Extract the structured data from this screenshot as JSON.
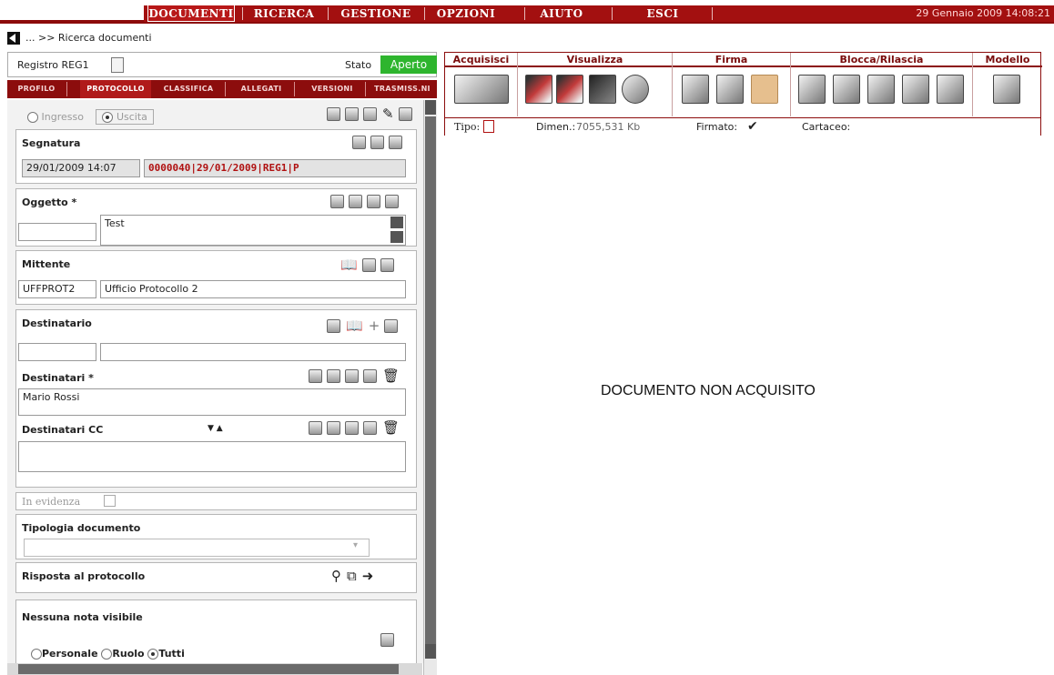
{
  "menu": {
    "items": [
      "DOCUMENTI",
      "RICERCA",
      "GESTIONE",
      "OPZIONI",
      "AIUTO",
      "ESCI"
    ],
    "datetime": "29 Gennaio 2009 14:08:21"
  },
  "breadcrumb": "... >> Ricerca documenti",
  "registro": {
    "label": "Registro REG1",
    "stato_label": "Stato",
    "stato_value": "Aperto"
  },
  "tabs": [
    "PROFILO",
    "PROTOCOLLO",
    "CLASSIFICA",
    "ALLEGATI",
    "VERSIONI",
    "TRASMISS.NI"
  ],
  "direction": {
    "ingresso": "Ingresso",
    "uscita": "Uscita"
  },
  "segnatura": {
    "title": "Segnatura",
    "date": "29/01/2009 14:07",
    "code": "0000040|29/01/2009|REG1|P"
  },
  "oggetto": {
    "title": "Oggetto *",
    "text": "Test"
  },
  "mittente": {
    "title": "Mittente",
    "code": "UFFPROT2",
    "desc": "Ufficio Protocollo 2"
  },
  "destinatario": {
    "title": "Destinatario"
  },
  "destinatari": {
    "title": "Destinatari *",
    "value": "Mario Rossi"
  },
  "destinatari_cc": {
    "title": "Destinatari CC"
  },
  "evidenza": {
    "label": "In evidenza"
  },
  "tipologia": {
    "title": "Tipologia documento"
  },
  "risposta": {
    "title": "Risposta al protocollo"
  },
  "note": {
    "title": "Nessuna nota visibile",
    "options": [
      "Personale",
      "Ruolo",
      "Tutti"
    ]
  },
  "toolbar": {
    "groups": [
      "Acquisisci",
      "Visualizza",
      "Firma",
      "Blocca/Rilascia",
      "Modello"
    ],
    "info": {
      "tipo_label": "Tipo:",
      "dimen_label": "Dimen.:",
      "dimen_value": "7055,531 Kb",
      "firmato_label": "Firmato:",
      "firmato_mark": "✔",
      "cartaceo_label": "Cartaceo:"
    }
  },
  "main_message": "DOCUMENTO NON ACQUISITO",
  "colors": {
    "brand_red": "#8c0d0d",
    "status_green": "#2eb52e",
    "code_red": "#b01010"
  }
}
